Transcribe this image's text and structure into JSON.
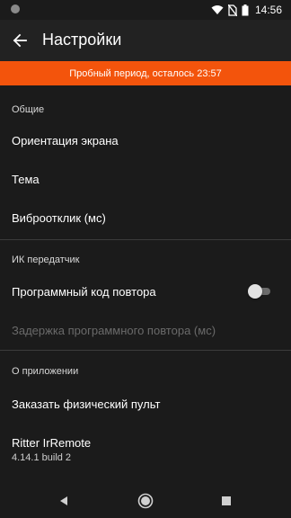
{
  "status_bar": {
    "time": "14:56",
    "icons": [
      "notification-dot-icon",
      "wifi-icon",
      "no-sim-icon",
      "battery-icon"
    ]
  },
  "app_bar": {
    "title": "Настройки",
    "back_icon": "arrow-back-icon"
  },
  "trial_banner": {
    "text": "Пробный период, осталось 23:57",
    "color": "#f3540c"
  },
  "sections": {
    "general": {
      "header": "Общие",
      "items": [
        "Ориентация экрана",
        "Тема",
        "Виброотклик (мс)"
      ]
    },
    "ir": {
      "header": "ИК передатчик",
      "repeat_code_label": "Программный код повтора",
      "repeat_code_enabled": false,
      "repeat_delay_label": "Задержка программного повтора (мс)"
    },
    "about": {
      "header": "О приложении",
      "order_remote": "Заказать физический пульт",
      "app_name": "Ritter IrRemote",
      "version": "4.14.1 build 2"
    }
  },
  "nav_bar": {
    "icons": [
      "back-triangle-icon",
      "home-circle-icon",
      "recents-square-icon"
    ]
  }
}
